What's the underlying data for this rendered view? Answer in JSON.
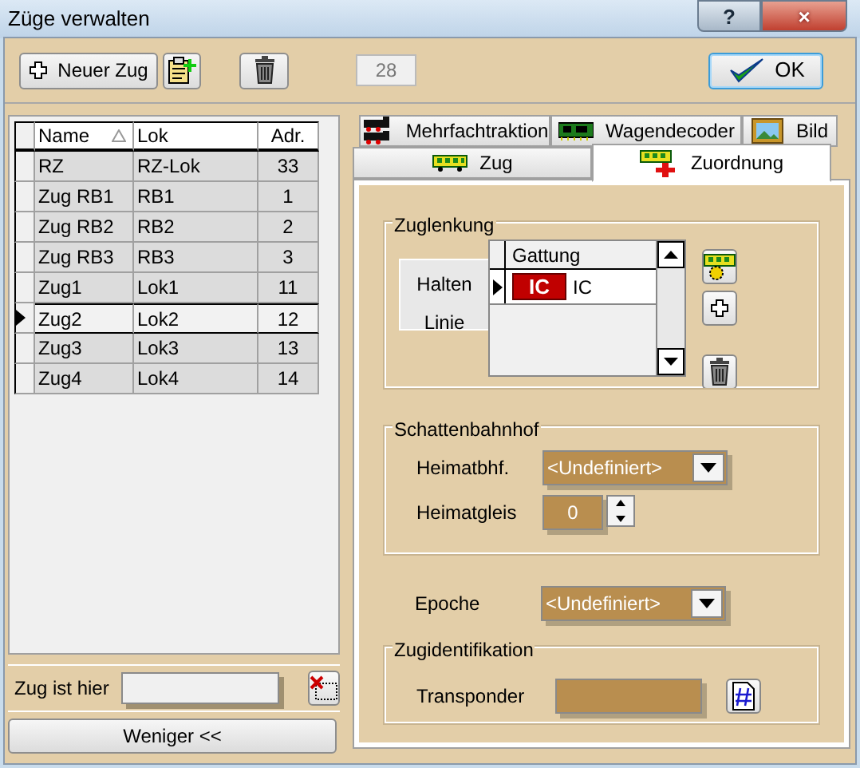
{
  "window": {
    "title": "Züge verwalten",
    "help_button": "?",
    "close_button": "×"
  },
  "toolbar": {
    "new_button": "Neuer Zug",
    "count": "28",
    "ok_button": "OK"
  },
  "train_table": {
    "columns": [
      "Name",
      "Lok",
      "Adr."
    ],
    "rows": [
      {
        "name": "RZ",
        "lok": "RZ-Lok",
        "address": "33",
        "selected": false
      },
      {
        "name": "Zug RB1",
        "lok": "RB1",
        "address": "1",
        "selected": false
      },
      {
        "name": "Zug RB2",
        "lok": "RB2",
        "address": "2",
        "selected": false
      },
      {
        "name": "Zug RB3",
        "lok": "RB3",
        "address": "3",
        "selected": false
      },
      {
        "name": "Zug1",
        "lok": "Lok1",
        "address": "11",
        "selected": false
      },
      {
        "name": "Zug2",
        "lok": "Lok2",
        "address": "12",
        "selected": true
      },
      {
        "name": "Zug3",
        "lok": "Lok3",
        "address": "13",
        "selected": false
      },
      {
        "name": "Zug4",
        "lok": "Lok4",
        "address": "14",
        "selected": false
      }
    ]
  },
  "location": {
    "label": "Zug ist hier"
  },
  "less_button": "Weniger <<",
  "tab_rows": [
    [
      {
        "label": "Mehrfachtraktion",
        "kind": "loco",
        "selected": false
      },
      {
        "label": "Wagendecoder",
        "kind": "decoder",
        "selected": false
      },
      {
        "label": "Bild",
        "kind": "picture",
        "selected": false
      }
    ],
    [
      {
        "label": "Zug",
        "kind": "wagon",
        "selected": false
      },
      {
        "label": "Zuordnung",
        "kind": "assign",
        "selected": true
      }
    ]
  ],
  "zuglenkung": {
    "title": "Zuglenkung",
    "side_labels": [
      "Halten",
      "Linie"
    ],
    "column": "Gattung",
    "rows": [
      {
        "badge": "IC",
        "name": "IC",
        "selected": true
      }
    ]
  },
  "schattenbahnhof": {
    "title": "Schattenbahnhof",
    "home_station_label": "Heimatbhf.",
    "home_station": "<Undefiniert>",
    "home_track_label": "Heimatgleis",
    "home_track": "0"
  },
  "epoche": {
    "label": "Epoche",
    "value": "<Undefiniert>"
  },
  "zugidentifikation": {
    "title": "Zugidentifikation",
    "transponder_label": "Transponder"
  }
}
